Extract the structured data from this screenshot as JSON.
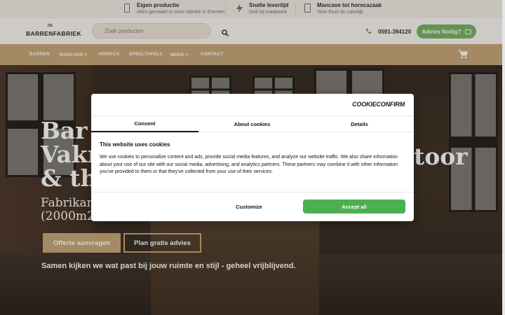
{
  "usp": [
    {
      "title": "Eigen productie",
      "subtitle": "Alles gemaakt in onze fabriek in Emmen",
      "icon": "phone-portrait-icon"
    },
    {
      "title": "Snelle levertijd",
      "subtitle": "Ook bij maatwerk",
      "icon": "lightning-icon"
    },
    {
      "title": "Mancave tot horecazaak",
      "subtitle": "Voor thuis én zakelijk",
      "icon": "tablet-icon"
    }
  ],
  "header": {
    "logo_small": "DE",
    "logo_main": "BARRENFABRIEK",
    "search_placeholder": "Zoek producten",
    "phone": "0591-394120",
    "advice_button": "Advies Nodig?"
  },
  "nav": {
    "items": [
      "BARREN",
      "MANCAVE",
      "HORECA",
      "SPEELTAFELS",
      "MEER",
      "CONTACT"
    ]
  },
  "hero": {
    "title_line1": "Bar k",
    "title_line2": "Vakm",
    "title_line3": "& thu",
    "title_end": "toor",
    "subtitle_line1": "Fabrikan",
    "subtitle_line2": "(2000m2",
    "btn_offer": "Offerte aanvragen",
    "btn_plan": "Plan gratis advies",
    "tagline": "Samen kijken we wat past bij jouw ruimte en stijl - geheel vrijblijvend."
  },
  "cookie": {
    "brand": "COOKIECONFIRM",
    "tabs": [
      "Consent",
      "About cookies",
      "Details"
    ],
    "active_tab": "Consent",
    "title": "This website uses cookies",
    "text": "We use cookies to personalize content and ads, provide social media features, and analyze our website traffic. We also share information about your use of our site with our social media, advertising, and analytics partners. These partners may combine it with other information you've provided to them or that they've collected from your use of their services.",
    "customize": "Customize",
    "accept": "Accept all"
  },
  "colors": {
    "accent": "#c9a97a",
    "green": "#79b466",
    "accept_green": "#4caf50"
  }
}
